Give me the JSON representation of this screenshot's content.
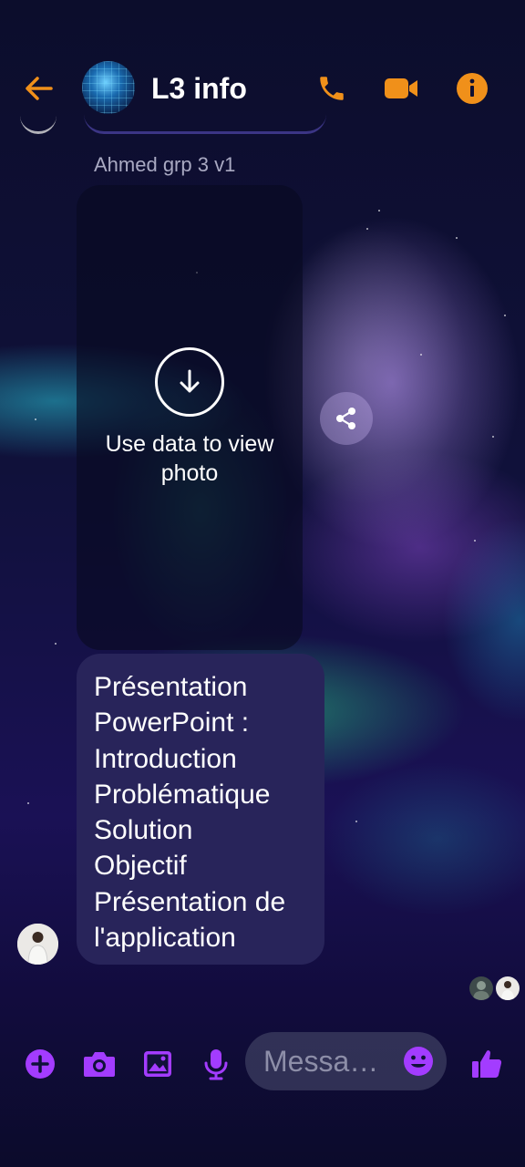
{
  "header": {
    "title": "L3 info",
    "back_icon": "arrow-left-icon",
    "call_icon": "phone-icon",
    "video_icon": "video-camera-icon",
    "info_icon": "info-icon",
    "accent_color": "#f0901a"
  },
  "thread": {
    "sender_name": "Ahmed grp 3 v1",
    "photo_message": {
      "caption": "Use data to view photo",
      "icon": "download-icon"
    },
    "share_icon": "share-icon",
    "text_message": {
      "lines": [
        "Présentation",
        "PowerPoint :",
        "Introduction",
        "Problématique",
        "Solution",
        "Objectif",
        "Présentation de",
        "l'application"
      ],
      "bubble_color": "#28245a"
    }
  },
  "composer": {
    "placeholder": "Messa…",
    "icons": [
      "plus-icon",
      "camera-icon",
      "image-icon",
      "microphone-icon",
      "emoji-icon",
      "thumbs-up-icon"
    ],
    "accent_color": "#a33cff"
  }
}
